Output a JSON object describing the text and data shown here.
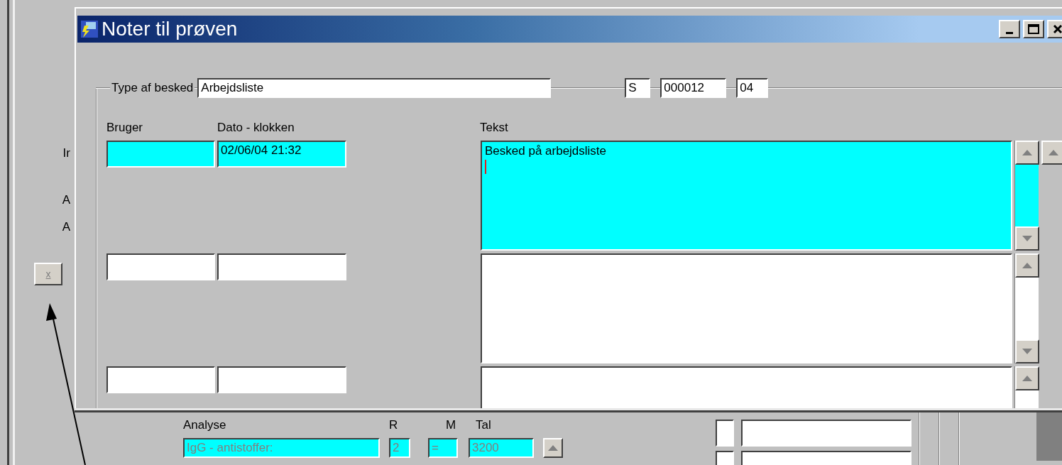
{
  "background_window": {
    "side_labels": [
      "Ir",
      "A",
      "A"
    ],
    "side_button": {
      "label": "x"
    },
    "analysis": {
      "columns": [
        "Analyse",
        "R",
        "M",
        "Tal"
      ],
      "row": {
        "analyse": "IgG - antistoffer:",
        "r": "2",
        "m": "=",
        "tal": "3200",
        "disabled": true
      }
    }
  },
  "dialog": {
    "title": "Noter til prøven",
    "message_type": {
      "label": "Type af besked",
      "value": "Arbejdsliste"
    },
    "sample_id": [
      "S",
      "000012",
      "04"
    ],
    "columns": [
      "Bruger",
      "Dato - klokken",
      "Tekst"
    ],
    "notes": [
      {
        "time": "02/06/04 21:32",
        "text": "Besked på arbejdsliste",
        "selected": true
      },
      {
        "selected": false
      },
      {
        "selected": false
      }
    ]
  }
}
